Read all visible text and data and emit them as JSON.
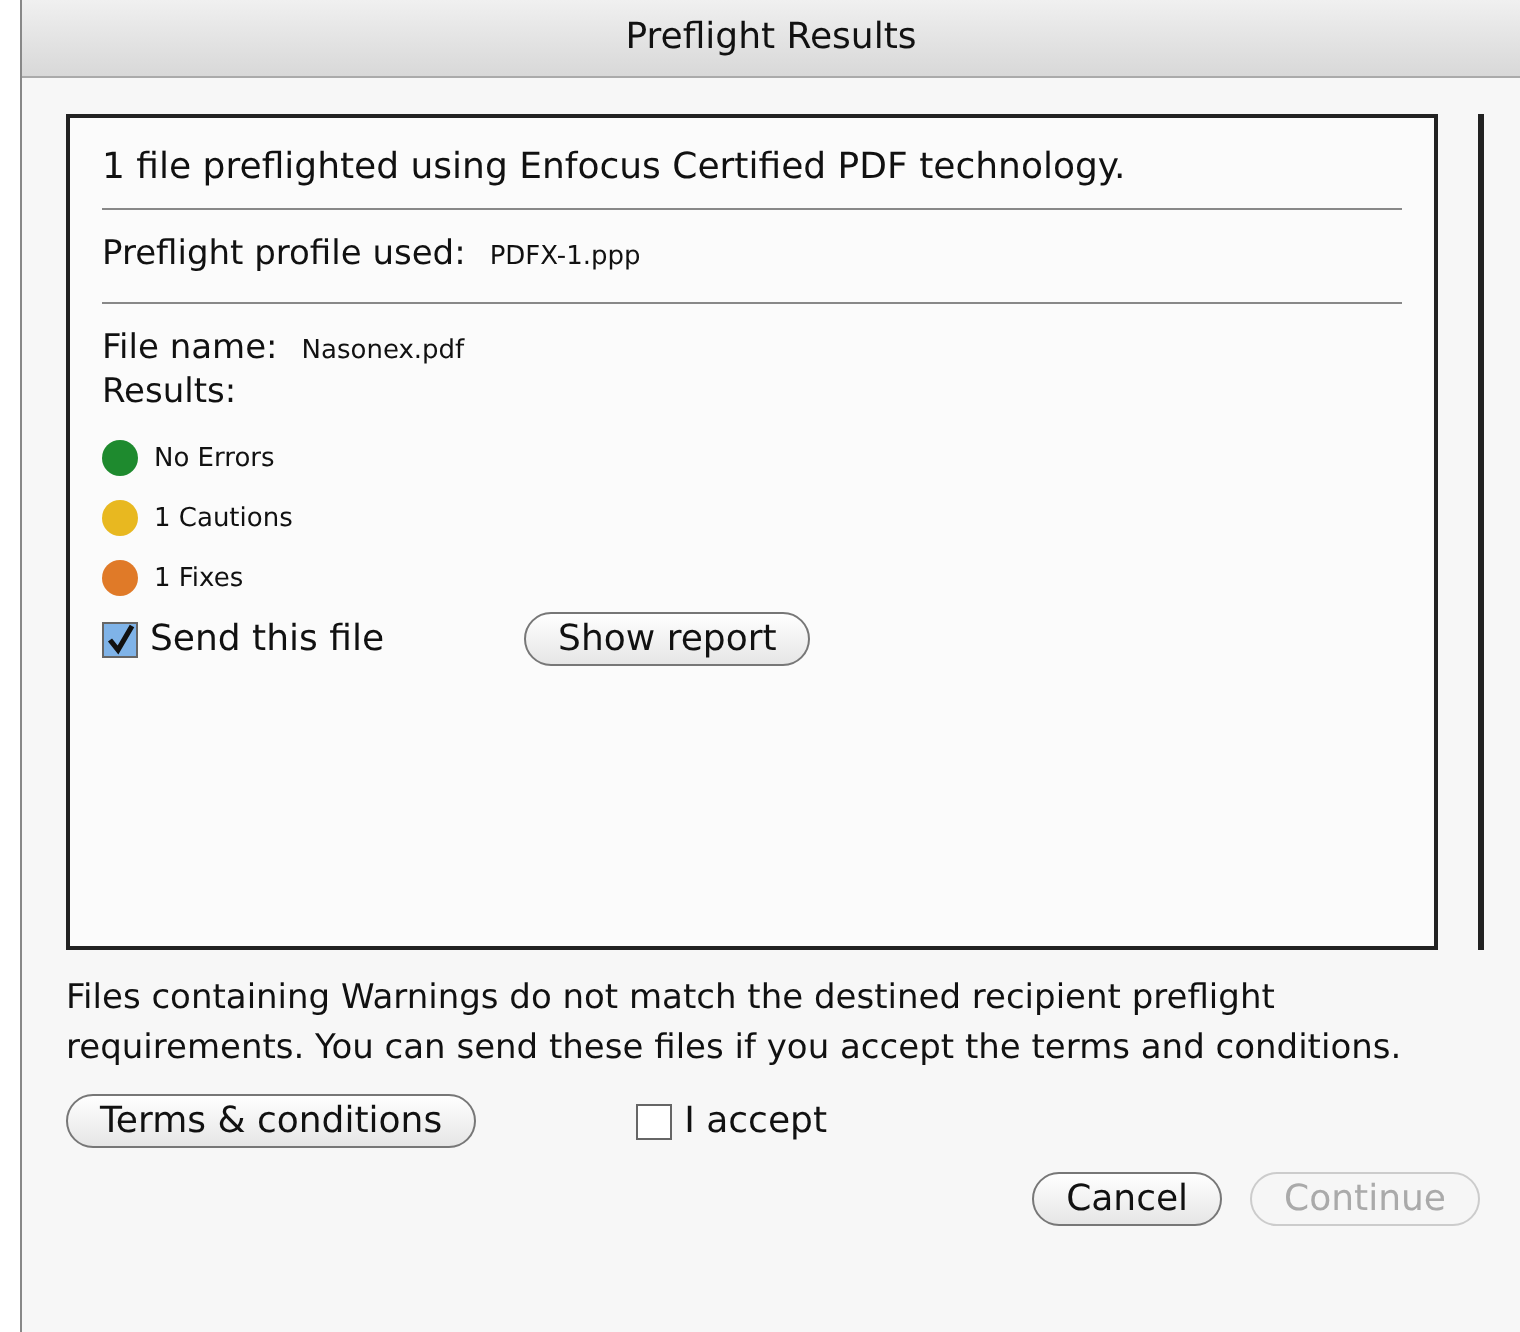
{
  "window": {
    "title": "Preflight Results"
  },
  "summary": "1 file preflighted using Enfocus Certified PDF technology.",
  "profile": {
    "label": "Preflight profile used:",
    "value": "PDFX-1.ppp"
  },
  "file": {
    "label": "File name:",
    "value": "Nasonex.pdf"
  },
  "results_label": "Results:",
  "results": [
    {
      "text": "No Errors",
      "color": "#1e8a2e"
    },
    {
      "text": "1 Cautions",
      "color": "#e8b820"
    },
    {
      "text": "1 Fixes",
      "color": "#e07a28"
    }
  ],
  "send": {
    "label": "Send this file",
    "checked": true
  },
  "show_report": "Show report",
  "notice": "Files containing Warnings do not match the destined recipient preflight requirements. You can send these files if you accept the terms and conditions.",
  "terms_button": "Terms & conditions",
  "accept": {
    "label": "I accept",
    "checked": false
  },
  "buttons": [
    {
      "label": "Cancel",
      "disabled": false
    },
    {
      "label": "Continue",
      "disabled": true
    }
  ]
}
